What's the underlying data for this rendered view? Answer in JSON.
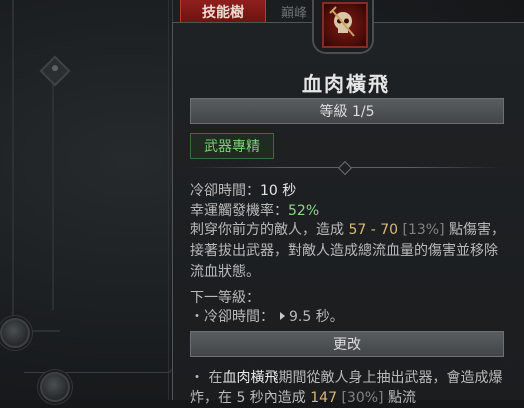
{
  "tabs": {
    "active_label": "技能樹",
    "inactive_label": "巔峰"
  },
  "tooltip": {
    "skill_icon": "skull-icon",
    "title": "血肉橫飛",
    "rank_label": "等級 1/5",
    "tag_label": "武器專精",
    "cooldown_label": "冷卻時間：",
    "cooldown_value": "10 秒",
    "lucky_hit_label": "幸運觸發機率：",
    "lucky_hit_value": "52%",
    "desc_part1": "刺穿你前方的敵人，造成 ",
    "desc_damage_range": "57 - 70",
    "desc_damage_pct": "[13%]",
    "desc_part2": " 點傷害，接著拔出武器，對敵人造成總流血量的傷害並移除流血狀態。",
    "next_rank_title": "下一等級：",
    "next_rank_bullet": "・",
    "next_rank_label": "冷卻時間：",
    "next_rank_value": "9.5 秒。",
    "modifier_bar_label": "更改",
    "mod_bullet": "・",
    "mod_part1": "在",
    "mod_skill_name": "血肉橫飛",
    "mod_part2": "期間從敵人身上抽出武器，會造成爆炸，在 5 秒內造成 ",
    "mod_value": "147",
    "mod_pct": "[30%]",
    "mod_part3": " 點流"
  },
  "colors": {
    "tab_active": "#8f1f1d",
    "tag_green": "#7ccf78",
    "lucky_green": "#8fd48a",
    "damage_gold": "#d9b77a"
  }
}
